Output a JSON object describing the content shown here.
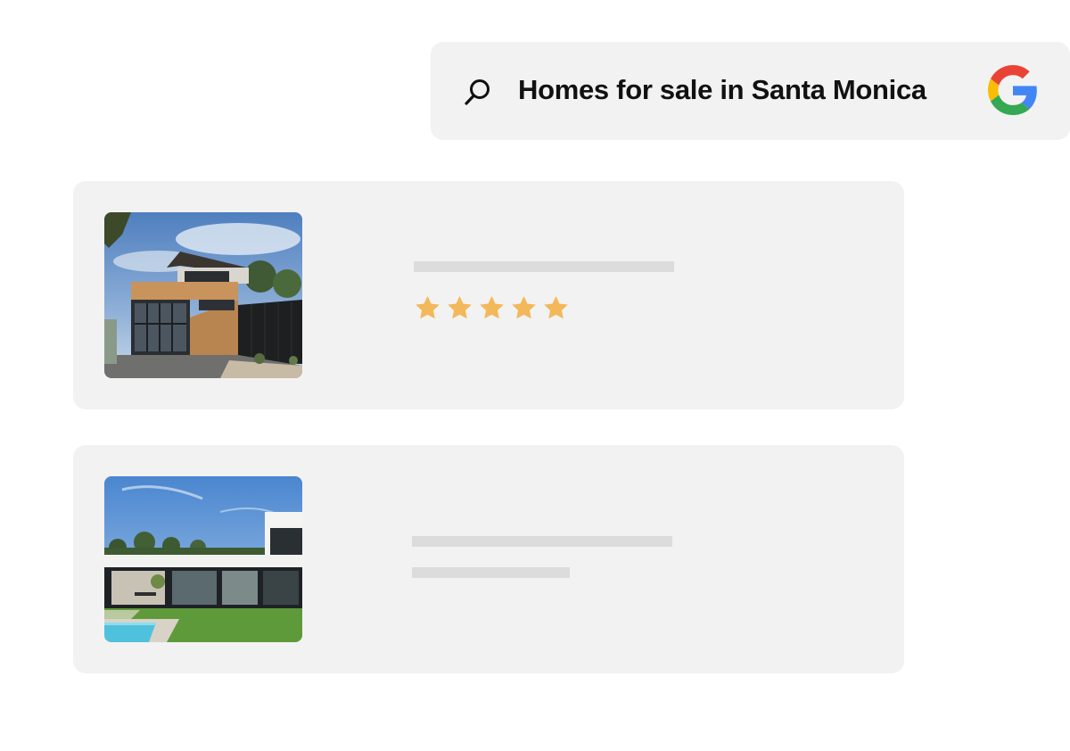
{
  "search": {
    "query": "Homes for sale in Santa Monica",
    "icon": "search-icon",
    "engine_icon": "google-icon"
  },
  "results": [
    {
      "image": "modern-house-wood-facade-photo",
      "rating": 5,
      "rating_max": 5
    },
    {
      "image": "modern-house-pool-lawn-photo"
    }
  ],
  "colors": {
    "background": "#ffffff",
    "card": "#f2f2f2",
    "placeholder": "#dcdcdc",
    "star": "#f2b85a",
    "google_blue": "#4285F4",
    "google_red": "#EA4335",
    "google_yellow": "#FBBC05",
    "google_green": "#34A853"
  }
}
